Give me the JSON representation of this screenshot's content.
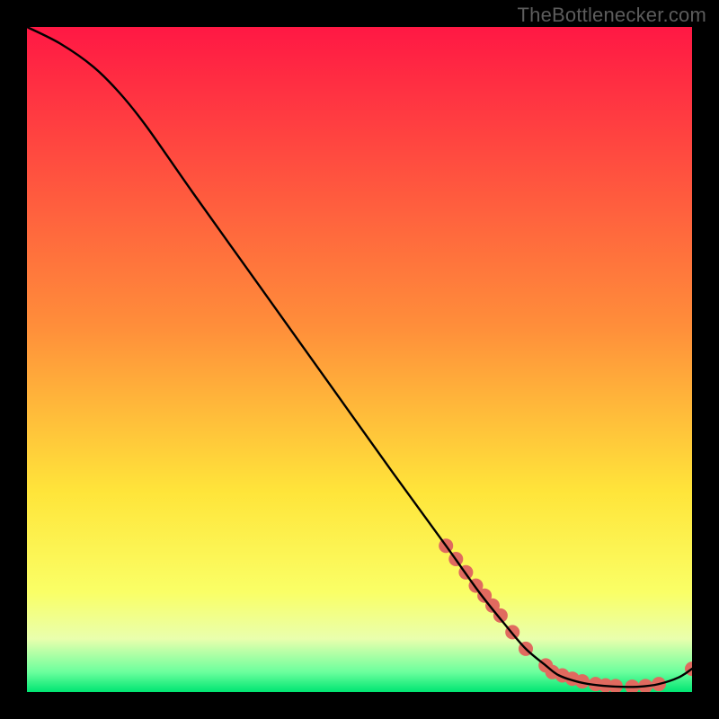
{
  "attribution": "TheBottlenecker.com",
  "chart_data": {
    "type": "line",
    "title": "",
    "xlabel": "",
    "ylabel": "",
    "xlim": [
      0,
      100
    ],
    "ylim": [
      0,
      100
    ],
    "grid": false,
    "gradient_stops": [
      {
        "offset": 0,
        "color": "#ff1844"
      },
      {
        "offset": 0.45,
        "color": "#ff8e3a"
      },
      {
        "offset": 0.7,
        "color": "#ffe53a"
      },
      {
        "offset": 0.85,
        "color": "#faff66"
      },
      {
        "offset": 0.92,
        "color": "#e9ffad"
      },
      {
        "offset": 0.97,
        "color": "#6bff9d"
      },
      {
        "offset": 1.0,
        "color": "#00e572"
      }
    ],
    "series": [
      {
        "name": "curve",
        "color": "#000000",
        "x": [
          0,
          5,
          10,
          14,
          18,
          25,
          35,
          45,
          55,
          63,
          68,
          72,
          75,
          78,
          80,
          83,
          86,
          89,
          92,
          95,
          98,
          100
        ],
        "y": [
          100,
          97.5,
          94,
          90,
          85,
          75,
          61,
          47,
          33,
          22,
          15,
          10,
          6.5,
          4,
          2.5,
          1.5,
          1,
          0.8,
          0.8,
          1.2,
          2.2,
          3.5
        ]
      }
    ],
    "markers": {
      "name": "dots",
      "color": "#e06a5f",
      "r": 8,
      "x": [
        63,
        64.5,
        66,
        67.5,
        68.8,
        70,
        71.2,
        73,
        75,
        78,
        79,
        80.5,
        82,
        83.5,
        85.5,
        87,
        88.5,
        91,
        93,
        95,
        100
      ],
      "y": [
        22,
        20,
        18,
        16,
        14.5,
        13,
        11.5,
        9,
        6.5,
        4,
        3,
        2.5,
        2,
        1.6,
        1.2,
        1.0,
        0.9,
        0.8,
        0.9,
        1.2,
        3.5
      ]
    }
  }
}
